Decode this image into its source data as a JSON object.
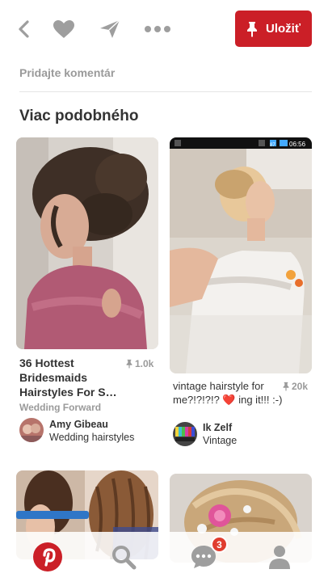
{
  "toolbar": {
    "save_label": "Uložiť"
  },
  "comment": {
    "placeholder": "Pridajte komentár"
  },
  "section": {
    "title": "Viac podobného"
  },
  "pins": [
    {
      "title": "36 Hottest Bridesmaids Hairstyles For S…",
      "save_count": "1.0k",
      "source": "Wedding Forward",
      "user": "Amy Gibeau",
      "board": "Wedding hairstyles"
    },
    {
      "description": "vintage hairstyle for me?!?!?!? ❤️ ing it!!! :-)",
      "save_count": "20k",
      "user": "Ik Zelf",
      "board": "Vintage",
      "status_time": "06:56",
      "status_battery": "87"
    }
  ],
  "notifications": {
    "count": "3"
  },
  "colors": {
    "brand_red": "#cb1f27",
    "icon_gray": "#9e9e9e",
    "badge_red": "#e03d2f"
  }
}
